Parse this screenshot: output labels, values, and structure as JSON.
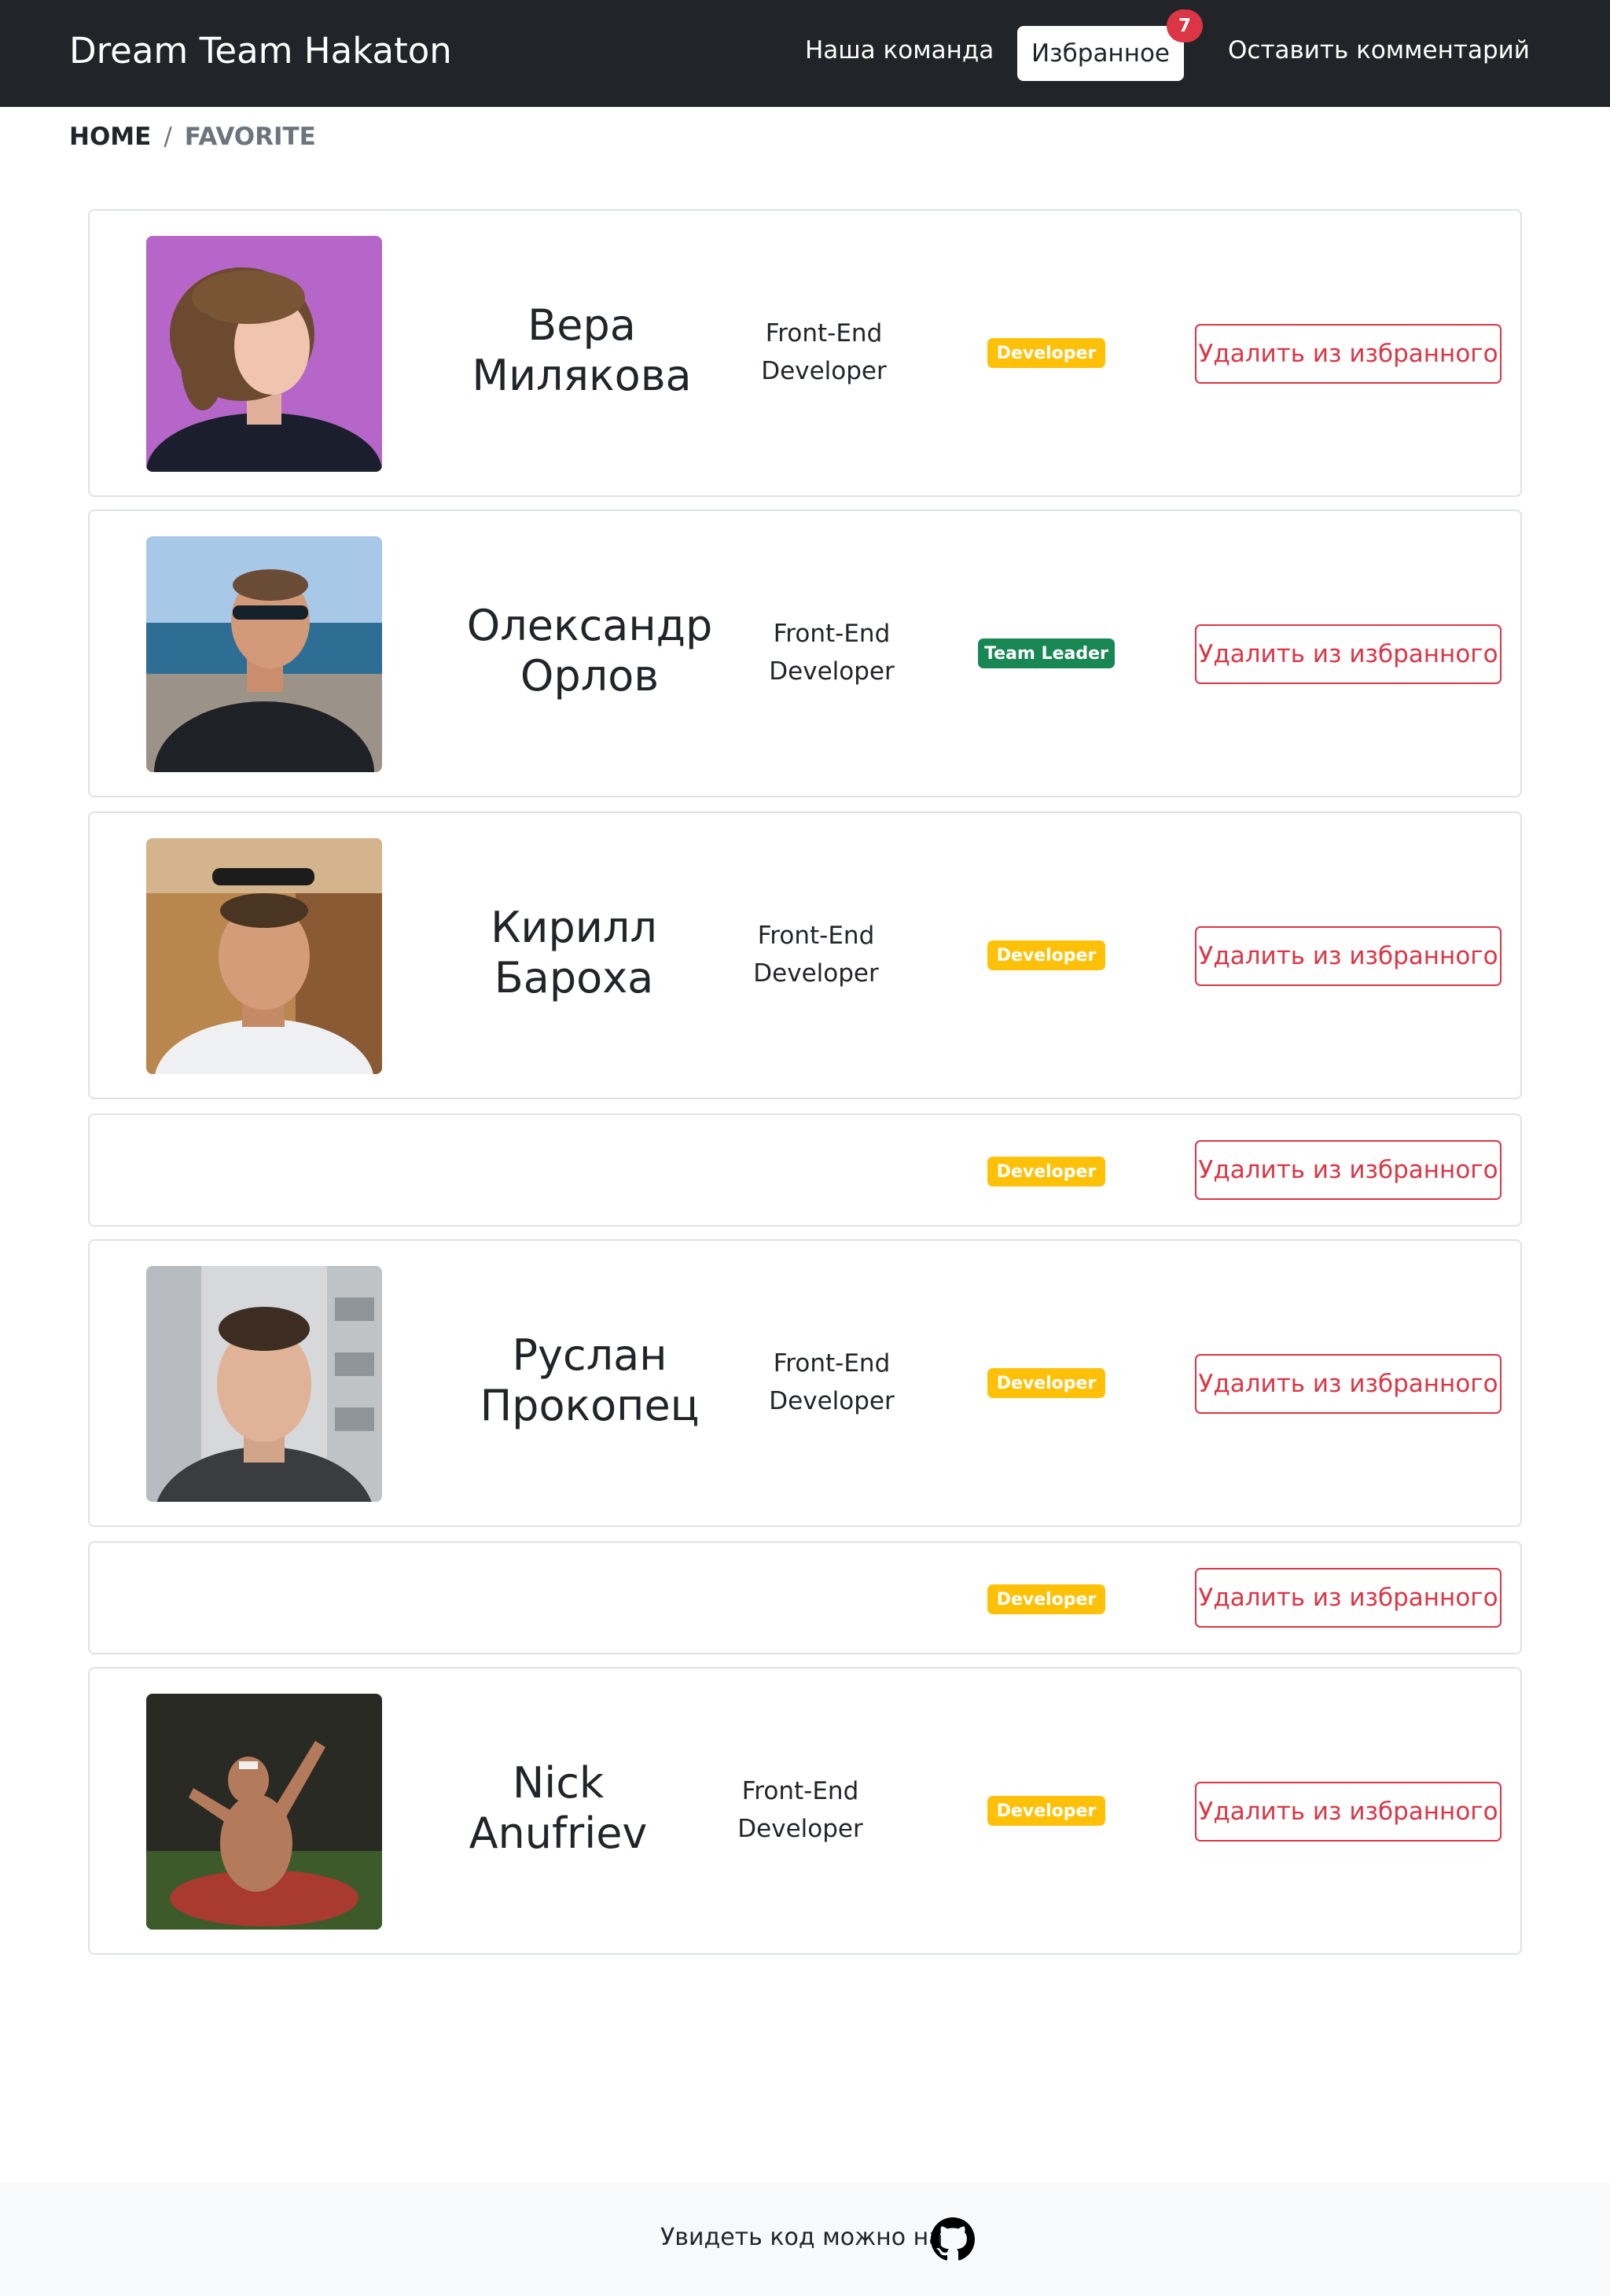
{
  "navbar": {
    "brand": "Dream Team Hakaton",
    "links": {
      "team": "Наша команда",
      "favorites": "Избранное",
      "favorites_count": "7",
      "comment": "Оставить комментарий"
    }
  },
  "breadcrumb": {
    "home": "HOME",
    "separator": "/",
    "current": "FAVORITE"
  },
  "members": [
    {
      "name": "Вера Милякова",
      "role": "Front-End Developer",
      "badge": "Developer",
      "badge_color": "#ffc107",
      "photo": "photo-vera",
      "remove_label": "Удалить из избранного"
    },
    {
      "name": "Олександр Орлов",
      "role": "Front-End Developer",
      "badge": "Team Leader",
      "badge_color": "#198754",
      "photo": "photo-oleksandr",
      "remove_label": "Удалить из избранного"
    },
    {
      "name": "Кирилл Бароха",
      "role": "Front-End Developer",
      "badge": "Developer",
      "badge_color": "#ffc107",
      "photo": "photo-kirill",
      "remove_label": "Удалить из избранного"
    },
    {
      "name": "",
      "role": "",
      "badge": "Developer",
      "badge_color": "#ffc107",
      "photo": "",
      "remove_label": "Удалить из избранного"
    },
    {
      "name": "Руслан Прокопец",
      "role": "Front-End Developer",
      "badge": "Developer",
      "badge_color": "#ffc107",
      "photo": "photo-ruslan",
      "remove_label": "Удалить из избранного"
    },
    {
      "name": "",
      "role": "",
      "badge": "Developer",
      "badge_color": "#ffc107",
      "photo": "",
      "remove_label": "Удалить из избранного"
    },
    {
      "name": "Nick Anufriev",
      "role": "Front-End Developer",
      "badge": "Developer",
      "badge_color": "#ffc107",
      "photo": "photo-nick",
      "remove_label": "Удалить из избранного"
    }
  ],
  "footer": {
    "text": "Увидеть код можно на",
    "icon": "github-icon"
  },
  "colors": {
    "navbar_bg": "#212529",
    "danger": "#dc3545",
    "warning": "#ffc107",
    "success": "#198754",
    "footer_bg": "#f8f9fa"
  }
}
